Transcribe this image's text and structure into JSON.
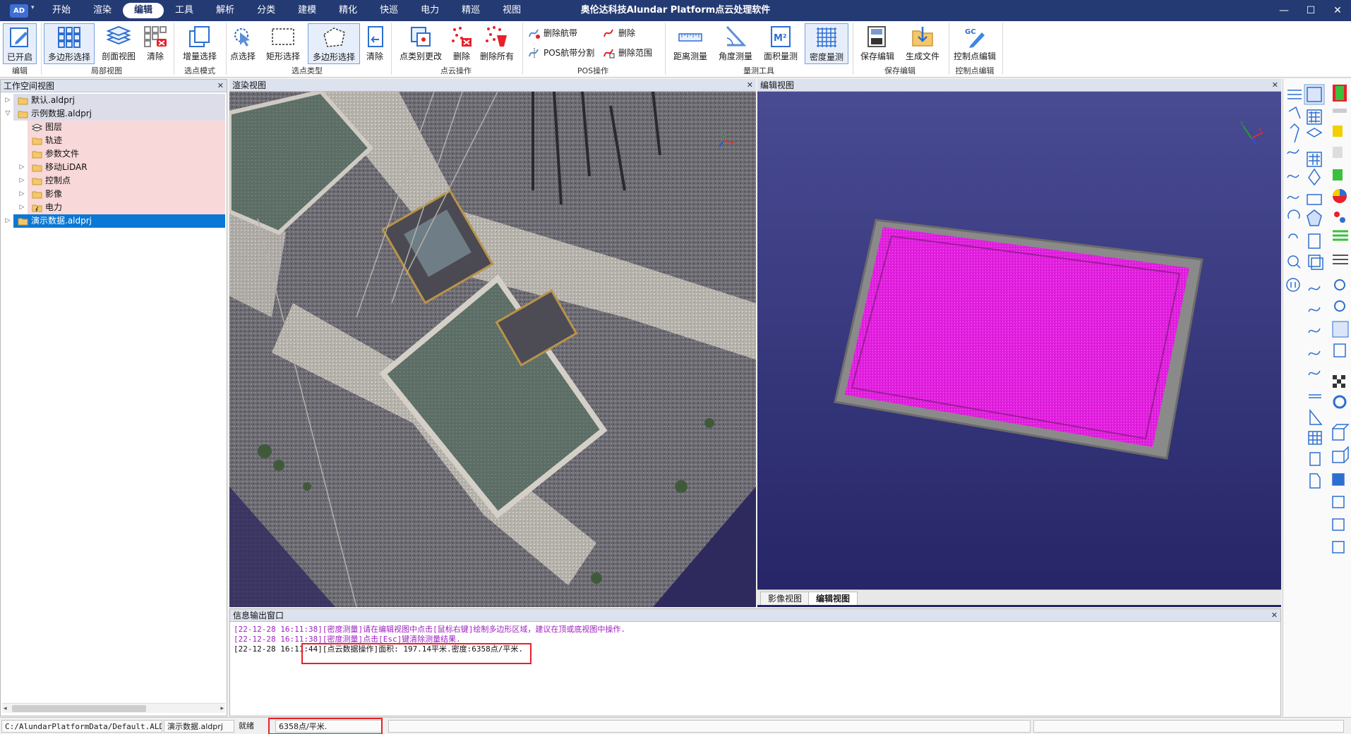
{
  "app": {
    "logo": "AD",
    "title": "奥伦达科技Alundar Platform点云处理软件"
  },
  "menu": {
    "tabs": [
      "开始",
      "渲染",
      "编辑",
      "工具",
      "解析",
      "分类",
      "建模",
      "精化",
      "快巡",
      "电力",
      "精巡",
      "视图"
    ],
    "active": "编辑"
  },
  "window": {
    "minimize": "—",
    "maximize": "☐",
    "close": "✕"
  },
  "ribbon": {
    "buttons": [
      {
        "id": "enabled",
        "label": "已开启",
        "icon": "pen-edit-icon"
      },
      {
        "id": "poly-select-partial",
        "label": "多边形选择",
        "icon": "grid-select-icon"
      },
      {
        "id": "profile-view",
        "label": "剖面视图",
        "icon": "layers-icon"
      },
      {
        "id": "clear-partial",
        "label": "清除",
        "icon": "grid-clear-icon"
      },
      {
        "id": "incremental-select",
        "label": "增量选择",
        "icon": "stack-copy-icon"
      },
      {
        "id": "point-select",
        "label": "点选择",
        "icon": "cursor-select-icon"
      },
      {
        "id": "rect-select",
        "label": "矩形选择",
        "icon": "rect-dashed-icon"
      },
      {
        "id": "poly-select",
        "label": "多边形选择",
        "icon": "polygon-icon"
      },
      {
        "id": "clear-select",
        "label": "清除",
        "icon": "undo-doc-icon"
      },
      {
        "id": "point-class-change",
        "label": "点类别更改",
        "icon": "class-change-icon"
      },
      {
        "id": "delete-points",
        "label": "删除",
        "icon": "point-delete-icon"
      },
      {
        "id": "delete-all",
        "label": "删除所有",
        "icon": "point-delete-all-icon"
      },
      {
        "id": "distance-measure",
        "label": "距离测量",
        "icon": "ruler-icon"
      },
      {
        "id": "angle-measure",
        "label": "角度测量",
        "icon": "angle-icon"
      },
      {
        "id": "area-measure",
        "label": "面积量测",
        "icon": "area-m2-icon"
      },
      {
        "id": "density-measure",
        "label": "密度量测",
        "icon": "density-grid-icon"
      },
      {
        "id": "save-edit",
        "label": "保存编辑",
        "icon": "save-edit-icon"
      },
      {
        "id": "generate-file",
        "label": "生成文件",
        "icon": "folder-download-icon"
      },
      {
        "id": "control-point-edit",
        "label": "控制点编辑",
        "icon": "gc-pen-icon"
      }
    ],
    "small_buttons": [
      {
        "id": "delete-strip",
        "label": "删除航带"
      },
      {
        "id": "pos-strip-split",
        "label": "POS航带分割"
      },
      {
        "id": "delete-pos",
        "label": "删除"
      },
      {
        "id": "delete-range",
        "label": "删除范围"
      }
    ],
    "groups": [
      "编辑",
      "局部视图",
      "选点模式",
      "选点类型",
      "点云操作",
      "POS操作",
      "量测工具",
      "保存编辑",
      "控制点编辑"
    ]
  },
  "workspace": {
    "title": "工作空间视图",
    "tree": [
      {
        "label": "默认.aldprj",
        "level": 0,
        "twisty": "▷",
        "icon": "folder-icon",
        "bg": "#dcdde8"
      },
      {
        "label": "示例数据.aldprj",
        "level": 0,
        "twisty": "▽",
        "icon": "folder-icon",
        "bg": "#dcdde8"
      },
      {
        "label": "图层",
        "level": 1,
        "twisty": "",
        "icon": "layers-icon",
        "bg": "#f8d8d8"
      },
      {
        "label": "轨迹",
        "level": 1,
        "twisty": "",
        "icon": "folder-icon",
        "bg": "#f8d8d8"
      },
      {
        "label": "参数文件",
        "level": 1,
        "twisty": "",
        "icon": "folder-icon",
        "bg": "#f8d8d8"
      },
      {
        "label": "移动LiDAR",
        "level": 1,
        "twisty": "▷",
        "icon": "folder-icon",
        "bg": "#f8d8d8"
      },
      {
        "label": "控制点",
        "level": 1,
        "twisty": "▷",
        "icon": "folder-icon",
        "bg": "#f8d8d8"
      },
      {
        "label": "影像",
        "level": 1,
        "twisty": "▷",
        "icon": "folder-icon",
        "bg": "#f8d8d8"
      },
      {
        "label": "电力",
        "level": 1,
        "twisty": "▷",
        "icon": "folder-power-icon",
        "bg": "#f8d8d8"
      },
      {
        "label": "演示数据.aldprj",
        "level": 0,
        "twisty": "▷",
        "icon": "folder-icon",
        "bg": "#0a78d4",
        "selected": true
      }
    ]
  },
  "render_view": {
    "title": "渲染视图"
  },
  "edit_view": {
    "title": "编辑视图"
  },
  "view_tabs": [
    "影像视图",
    "编辑视图"
  ],
  "log": {
    "title": "信息输出窗口",
    "lines": [
      {
        "text": "[22-12-28 16:11:38][密度测量]请在编辑视图中点击[鼠标右键]绘制多边形区域，建议在顶或底视图中操作.",
        "color": "#a020c0"
      },
      {
        "text": "[22-12-28 16:11:38][密度测量]点击[Esc]键清除测量结果.",
        "color": "#a020c0"
      },
      {
        "text": "[22-12-28 16:11:44][点云数据操作]面积: 197.14平米.密度:6358点/平米.",
        "color": "#111111"
      }
    ]
  },
  "status": {
    "path": "C:/AlundarPlatformData/Default.ALDWS",
    "project": "演示数据.aldprj",
    "state": "就绪",
    "density": "6358点/平米."
  },
  "colors": {
    "titlebar": "#233a73",
    "selection": "#0a78d4",
    "highlight": "#e8202a",
    "cloud": "#e31fe0"
  }
}
